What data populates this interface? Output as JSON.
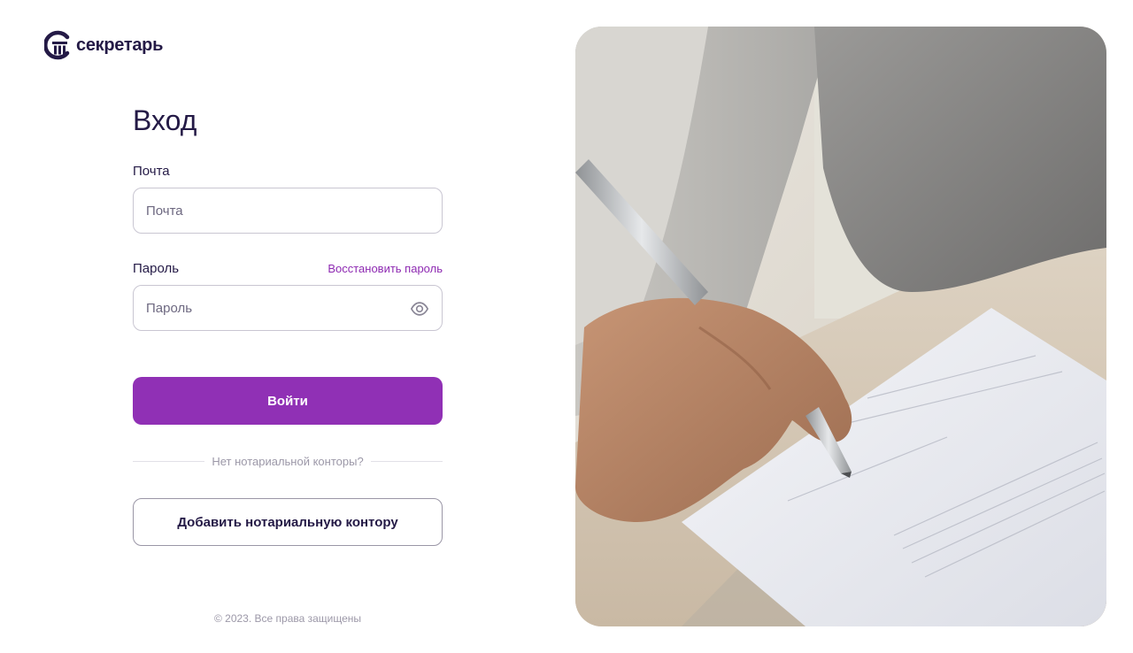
{
  "brand": {
    "name": "секретарь",
    "accent_color": "#9030b5",
    "text_color": "#241a46"
  },
  "login": {
    "title": "Вход",
    "email": {
      "label": "Почта",
      "placeholder": "Почта",
      "value": ""
    },
    "password": {
      "label": "Пароль",
      "placeholder": "Пароль",
      "value": "",
      "toggle_icon": "eye-icon"
    },
    "restore_link": "Восстановить пароль",
    "submit_label": "Войти",
    "divider_text": "Нет нотариальной конторы?",
    "add_office_label": "Добавить нотариальную контору"
  },
  "footer": {
    "copyright": "© 2023. Все права защищены"
  },
  "illustration": {
    "subject": "hand-signing-document-photo"
  }
}
